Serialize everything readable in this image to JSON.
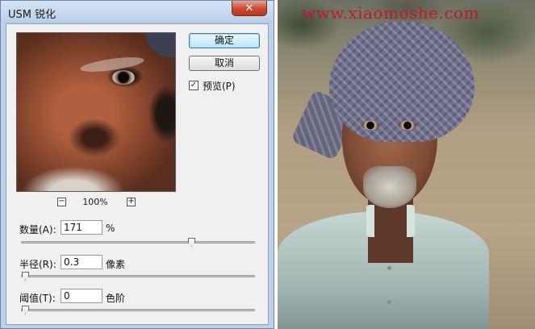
{
  "dialog": {
    "title": "USM 锐化",
    "close_glyph": "✕",
    "ok_label": "确定",
    "cancel_label": "取消",
    "preview_label": "预览(P)",
    "preview_checked": true,
    "zoom": {
      "minus_glyph": "−",
      "plus_glyph": "+",
      "level": "100%"
    },
    "amount": {
      "label": "数量(A):",
      "value": "171",
      "unit": "%",
      "slider_fraction": 0.74
    },
    "radius": {
      "label": "半径(R):",
      "value": "0.3",
      "unit": "像素",
      "slider_fraction": 0.0
    },
    "threshold": {
      "label": "阈值(T):",
      "value": "0",
      "unit": "色阶",
      "slider_fraction": 0.0
    }
  },
  "photo": {
    "watermark": "www.xiaomoshe.com"
  },
  "colors": {
    "title_bar": "#bcd0e8",
    "close_button": "#c9472d",
    "watermark": "#c0182c"
  }
}
